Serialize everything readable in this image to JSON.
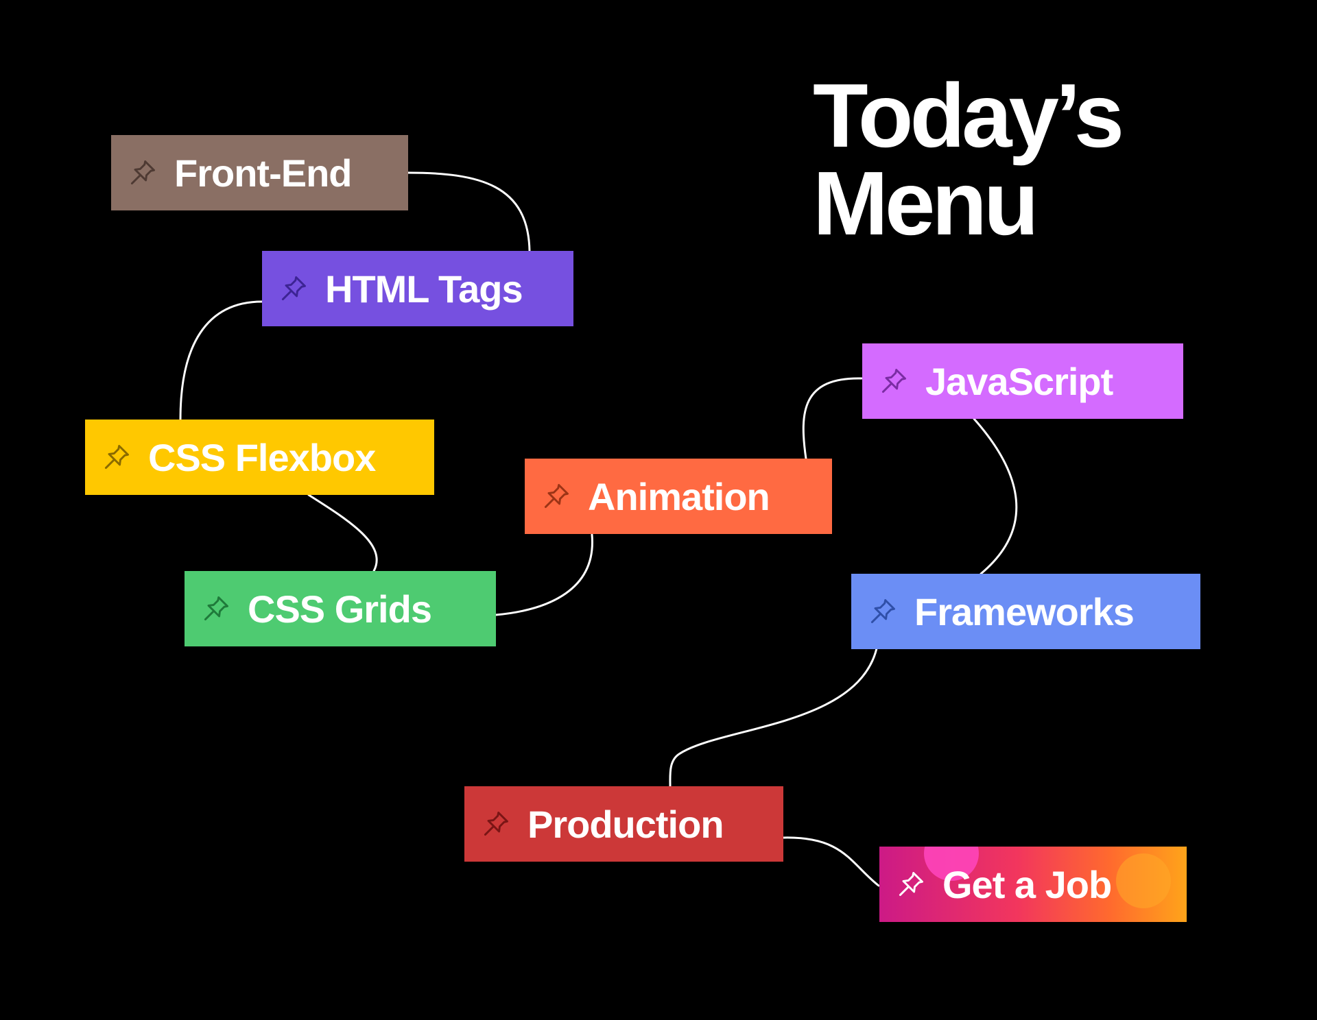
{
  "title": {
    "line1": "Today’s",
    "line2": "Menu"
  },
  "nodes": [
    {
      "id": "front-end",
      "label": "Front-End",
      "color": "#8a6f64",
      "icon": "pushpin-icon"
    },
    {
      "id": "html-tags",
      "label": "HTML Tags",
      "color": "#7650e0",
      "icon": "pushpin-icon"
    },
    {
      "id": "css-flexbox",
      "label": "CSS Flexbox",
      "color": "#ffc800",
      "icon": "pushpin-icon"
    },
    {
      "id": "css-grids",
      "label": "CSS Grids",
      "color": "#4ecb71",
      "icon": "pushpin-icon"
    },
    {
      "id": "animation",
      "label": "Animation",
      "color": "#ff6a42",
      "icon": "pushpin-icon"
    },
    {
      "id": "javascript",
      "label": "JavaScript",
      "color": "#d46bff",
      "icon": "pushpin-icon"
    },
    {
      "id": "frameworks",
      "label": "Frameworks",
      "color": "#6b8ef5",
      "icon": "pushpin-icon"
    },
    {
      "id": "production",
      "label": "Production",
      "color": "#cc3838",
      "icon": "pushpin-icon"
    },
    {
      "id": "get-a-job",
      "label": "Get a Job",
      "color": "gradient #cc1a86 → #ffa41a",
      "icon": "pushpin-icon"
    }
  ],
  "edges": [
    [
      "front-end",
      "html-tags"
    ],
    [
      "html-tags",
      "css-flexbox"
    ],
    [
      "css-flexbox",
      "css-grids"
    ],
    [
      "css-grids",
      "animation"
    ],
    [
      "animation",
      "javascript"
    ],
    [
      "javascript",
      "frameworks"
    ],
    [
      "frameworks",
      "production"
    ],
    [
      "production",
      "get-a-job"
    ]
  ],
  "colors": {
    "background": "#000000",
    "text": "#ffffff",
    "connector": "#ffffff"
  }
}
